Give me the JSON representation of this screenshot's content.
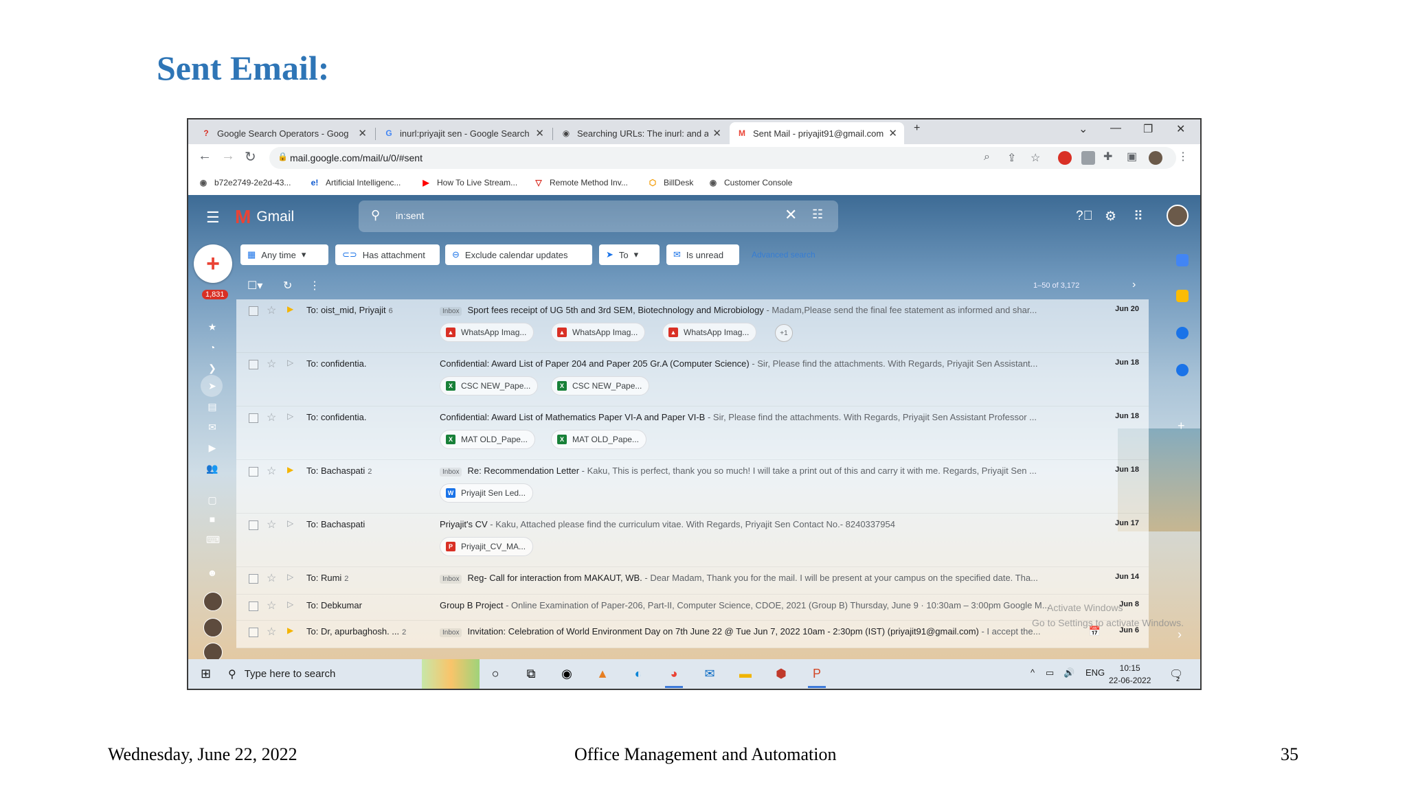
{
  "slide": {
    "title": "Sent Email:",
    "footer_date": "Wednesday, June 22, 2022",
    "footer_center": "Office Management and Automation",
    "page_number": "35"
  },
  "browser": {
    "tabs": [
      {
        "title": "Google Search Operators - Goog",
        "icon": "?"
      },
      {
        "title": "inurl:priyajit sen - Google Search",
        "icon": "G"
      },
      {
        "title": "Searching URLs: The inurl: and al",
        "icon": "◉"
      },
      {
        "title": "Sent Mail - priyajit91@gmail.com",
        "icon": "M"
      }
    ],
    "new_tab": "+",
    "url": "mail.google.com/mail/u/0/#sent",
    "bookmarks": [
      {
        "label": "b72e2749-2e2d-43...",
        "icon": "◉"
      },
      {
        "label": "Artificial Intelligenc...",
        "icon": "e!"
      },
      {
        "label": "How To Live Stream...",
        "icon": "▶"
      },
      {
        "label": "Remote Method Inv...",
        "icon": "▽"
      },
      {
        "label": "BillDesk",
        "icon": "⬡"
      },
      {
        "label": "Customer Console",
        "icon": "◉"
      }
    ]
  },
  "gmail": {
    "brand": "Gmail",
    "search_value": "in:sent",
    "unread_badge": "1,831",
    "chips": [
      {
        "label": "Any time",
        "icon": "▦",
        "caret": "▾"
      },
      {
        "label": "Has attachment",
        "icon": "⊂⊃",
        "caret": ""
      },
      {
        "label": "Exclude calendar updates",
        "icon": "⊖",
        "caret": ""
      },
      {
        "label": "To",
        "icon": "➤",
        "caret": "▾"
      },
      {
        "label": "Is unread",
        "icon": "✉",
        "caret": ""
      }
    ],
    "advanced_search": "Advanced search",
    "pagination": "1–50 of 3,172",
    "emails": [
      {
        "to": "To: oist_mid, Priyajit",
        "count": "6",
        "important": true,
        "label": "Inbox",
        "subject": "Sport fees receipt of UG 5th and 3rd SEM, Biotechnology and Microbiology",
        "snippet": " - Madam,Please send the final fee statement as informed and shar...",
        "date": "Jun 20",
        "attachments": [
          {
            "name": "WhatsApp Imag...",
            "type": "img"
          },
          {
            "name": "WhatsApp Imag...",
            "type": "img"
          },
          {
            "name": "WhatsApp Imag...",
            "type": "img"
          }
        ],
        "more": "+1"
      },
      {
        "to": "To: confidentia.",
        "count": "",
        "important": false,
        "label": "",
        "subject": "Confidential: Award List of Paper 204 and Paper 205 Gr.A (Computer Science)",
        "snippet": " - Sir, Please find the attachments. With Regards, Priyajit Sen Assistant...",
        "date": "Jun 18",
        "attachments": [
          {
            "name": "CSC NEW_Pape...",
            "type": "xls"
          },
          {
            "name": "CSC NEW_Pape...",
            "type": "xls"
          }
        ]
      },
      {
        "to": "To: confidentia.",
        "count": "",
        "important": false,
        "label": "",
        "subject": "Confidential: Award List of Mathematics Paper VI-A and Paper VI-B",
        "snippet": " - Sir, Please find the attachments. With Regards, Priyajit Sen Assistant Professor ...",
        "date": "Jun 18",
        "attachments": [
          {
            "name": "MAT OLD_Pape...",
            "type": "xls"
          },
          {
            "name": "MAT OLD_Pape...",
            "type": "xls"
          }
        ]
      },
      {
        "to": "To: Bachaspati",
        "count": "2",
        "important": true,
        "label": "Inbox",
        "subject": "Re: Recommendation Letter",
        "snippet": " - Kaku, This is perfect, thank you so much! I will take a print out of this and carry it with me. Regards, Priyajit Sen ...",
        "date": "Jun 18",
        "attachments": [
          {
            "name": "Priyajit Sen Led...",
            "type": "doc"
          }
        ]
      },
      {
        "to": "To: Bachaspati",
        "count": "",
        "important": false,
        "label": "",
        "subject": "Priyajit's CV",
        "snippet": " - Kaku, Attached please find the curriculum vitae. With Regards, Priyajit Sen Contact No.- 8240337954",
        "date": "Jun 17",
        "attachments": [
          {
            "name": "Priyajit_CV_MA...",
            "type": "pdf"
          }
        ]
      },
      {
        "to": "To: Rumi",
        "count": "2",
        "important": false,
        "label": "Inbox",
        "subject": "Reg- Call for interaction from MAKAUT, WB.",
        "snippet": " - Dear Madam, Thank you for the mail. I will be present at your campus on the specified date. Tha...",
        "date": "Jun 14",
        "attachments": []
      },
      {
        "to": "To: Debkumar",
        "count": "",
        "important": false,
        "label": "",
        "subject": "Group B Project",
        "snippet": " - Online Examination of Paper-206, Part-II, Computer Science, CDOE, 2021 (Group B) Thursday, June 9 · 10:30am – 3:00pm Google M...",
        "date": "Jun 8",
        "attachments": []
      },
      {
        "to": "To: Dr, apurbaghosh. ...",
        "count": "2",
        "important": true,
        "label": "Inbox",
        "subject": "Invitation: Celebration of World Environment Day on 7th June 22 @ Tue Jun 7, 2022 10am - 2:30pm (IST) (priyajit91@gmail.com)",
        "snippet": " - I accept the...",
        "date": "Jun 6",
        "attachments": []
      }
    ],
    "watermark_line1": "Activate Windows",
    "watermark_line2": "Go to Settings to activate Windows."
  },
  "taskbar": {
    "search_placeholder": "Type here to search",
    "language": "ENG",
    "time": "10:15",
    "date": "22-06-2022",
    "notification_count": "2"
  },
  "colors": {
    "slide_title": "#2e75b6",
    "gmail_red": "#ea4335",
    "chip_blue": "#1a73e8"
  }
}
